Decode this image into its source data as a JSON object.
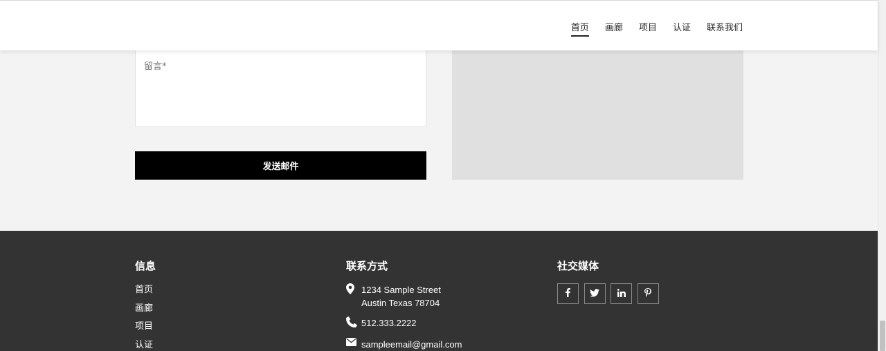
{
  "nav": {
    "items": [
      {
        "label": "首页",
        "active": true
      },
      {
        "label": "画廊"
      },
      {
        "label": "项目"
      },
      {
        "label": "认证"
      },
      {
        "label": "联系我们"
      }
    ]
  },
  "form": {
    "message_placeholder": "留言*",
    "send_label": "发送邮件"
  },
  "footer": {
    "info_title": "信息",
    "info_links": [
      "首页",
      "画廊",
      "项目",
      "认证"
    ],
    "contact_title": "联系方式",
    "address_line1": "1234 Sample Street",
    "address_line2": "Austin Texas 78704",
    "phone": "512.333.2222",
    "email": "sampleemail@gmail.com",
    "social_title": "社交媒体",
    "socials": [
      "facebook-icon",
      "twitter-icon",
      "linkedin-icon",
      "pinterest-icon"
    ]
  },
  "colors": {
    "footer_bg": "#333333",
    "button_bg": "#000000",
    "page_bg": "#f3f3f3"
  }
}
